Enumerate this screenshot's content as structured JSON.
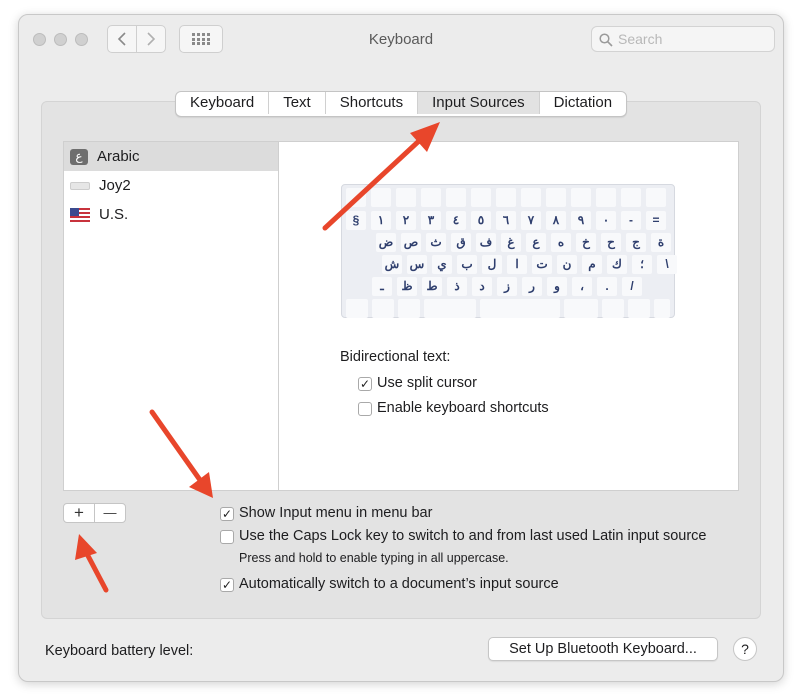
{
  "window": {
    "title": "Keyboard"
  },
  "search": {
    "placeholder": "Search"
  },
  "tabs": [
    "Keyboard",
    "Text",
    "Shortcuts",
    "Input Sources",
    "Dictation"
  ],
  "selected_tab": "Input Sources",
  "sources": [
    {
      "label": "Arabic",
      "icon": "arabic-letter-icon",
      "icon_text": "ع",
      "selected": true
    },
    {
      "label": "Joy2",
      "icon": "keyboard-layout-icon"
    },
    {
      "label": "U.S.",
      "icon": "us-flag-icon"
    }
  ],
  "keyboard_rows": [
    [
      "§",
      "١",
      "٢",
      "٣",
      "٤",
      "٥",
      "٦",
      "٧",
      "٨",
      "٩",
      "٠",
      "-",
      "="
    ],
    [
      "ض",
      "ص",
      "ث",
      "ق",
      "ف",
      "غ",
      "ع",
      "ه",
      "خ",
      "ح",
      "ج",
      "ة"
    ],
    [
      "ش",
      "س",
      "ي",
      "ب",
      "ل",
      "ا",
      "ت",
      "ن",
      "م",
      "ك",
      "؛",
      "\\"
    ],
    [
      "ـ",
      "ظ",
      "ط",
      "ذ",
      "د",
      "ز",
      "ر",
      "و",
      "،",
      ".",
      "/"
    ]
  ],
  "bidi": {
    "title": "Bidirectional text:",
    "split_cursor": "Use split cursor",
    "keyboard_shortcuts": "Enable keyboard shortcuts"
  },
  "options": {
    "show_menu": "Show Input menu in menu bar",
    "caps_lock": "Use the Caps Lock key to switch to and from last used Latin input source",
    "caps_hint": "Press and hold to enable typing in all uppercase.",
    "auto_switch": "Automatically switch to a document’s input source"
  },
  "list_buttons": {
    "add": "+",
    "remove": "—"
  },
  "footer": {
    "battery_label": "Keyboard battery level:",
    "setup_button": "Set Up Bluetooth Keyboard...",
    "help": "?"
  },
  "colors": {
    "annotation_arrow": "#e8462b",
    "key_text": "#2f3f6e"
  }
}
